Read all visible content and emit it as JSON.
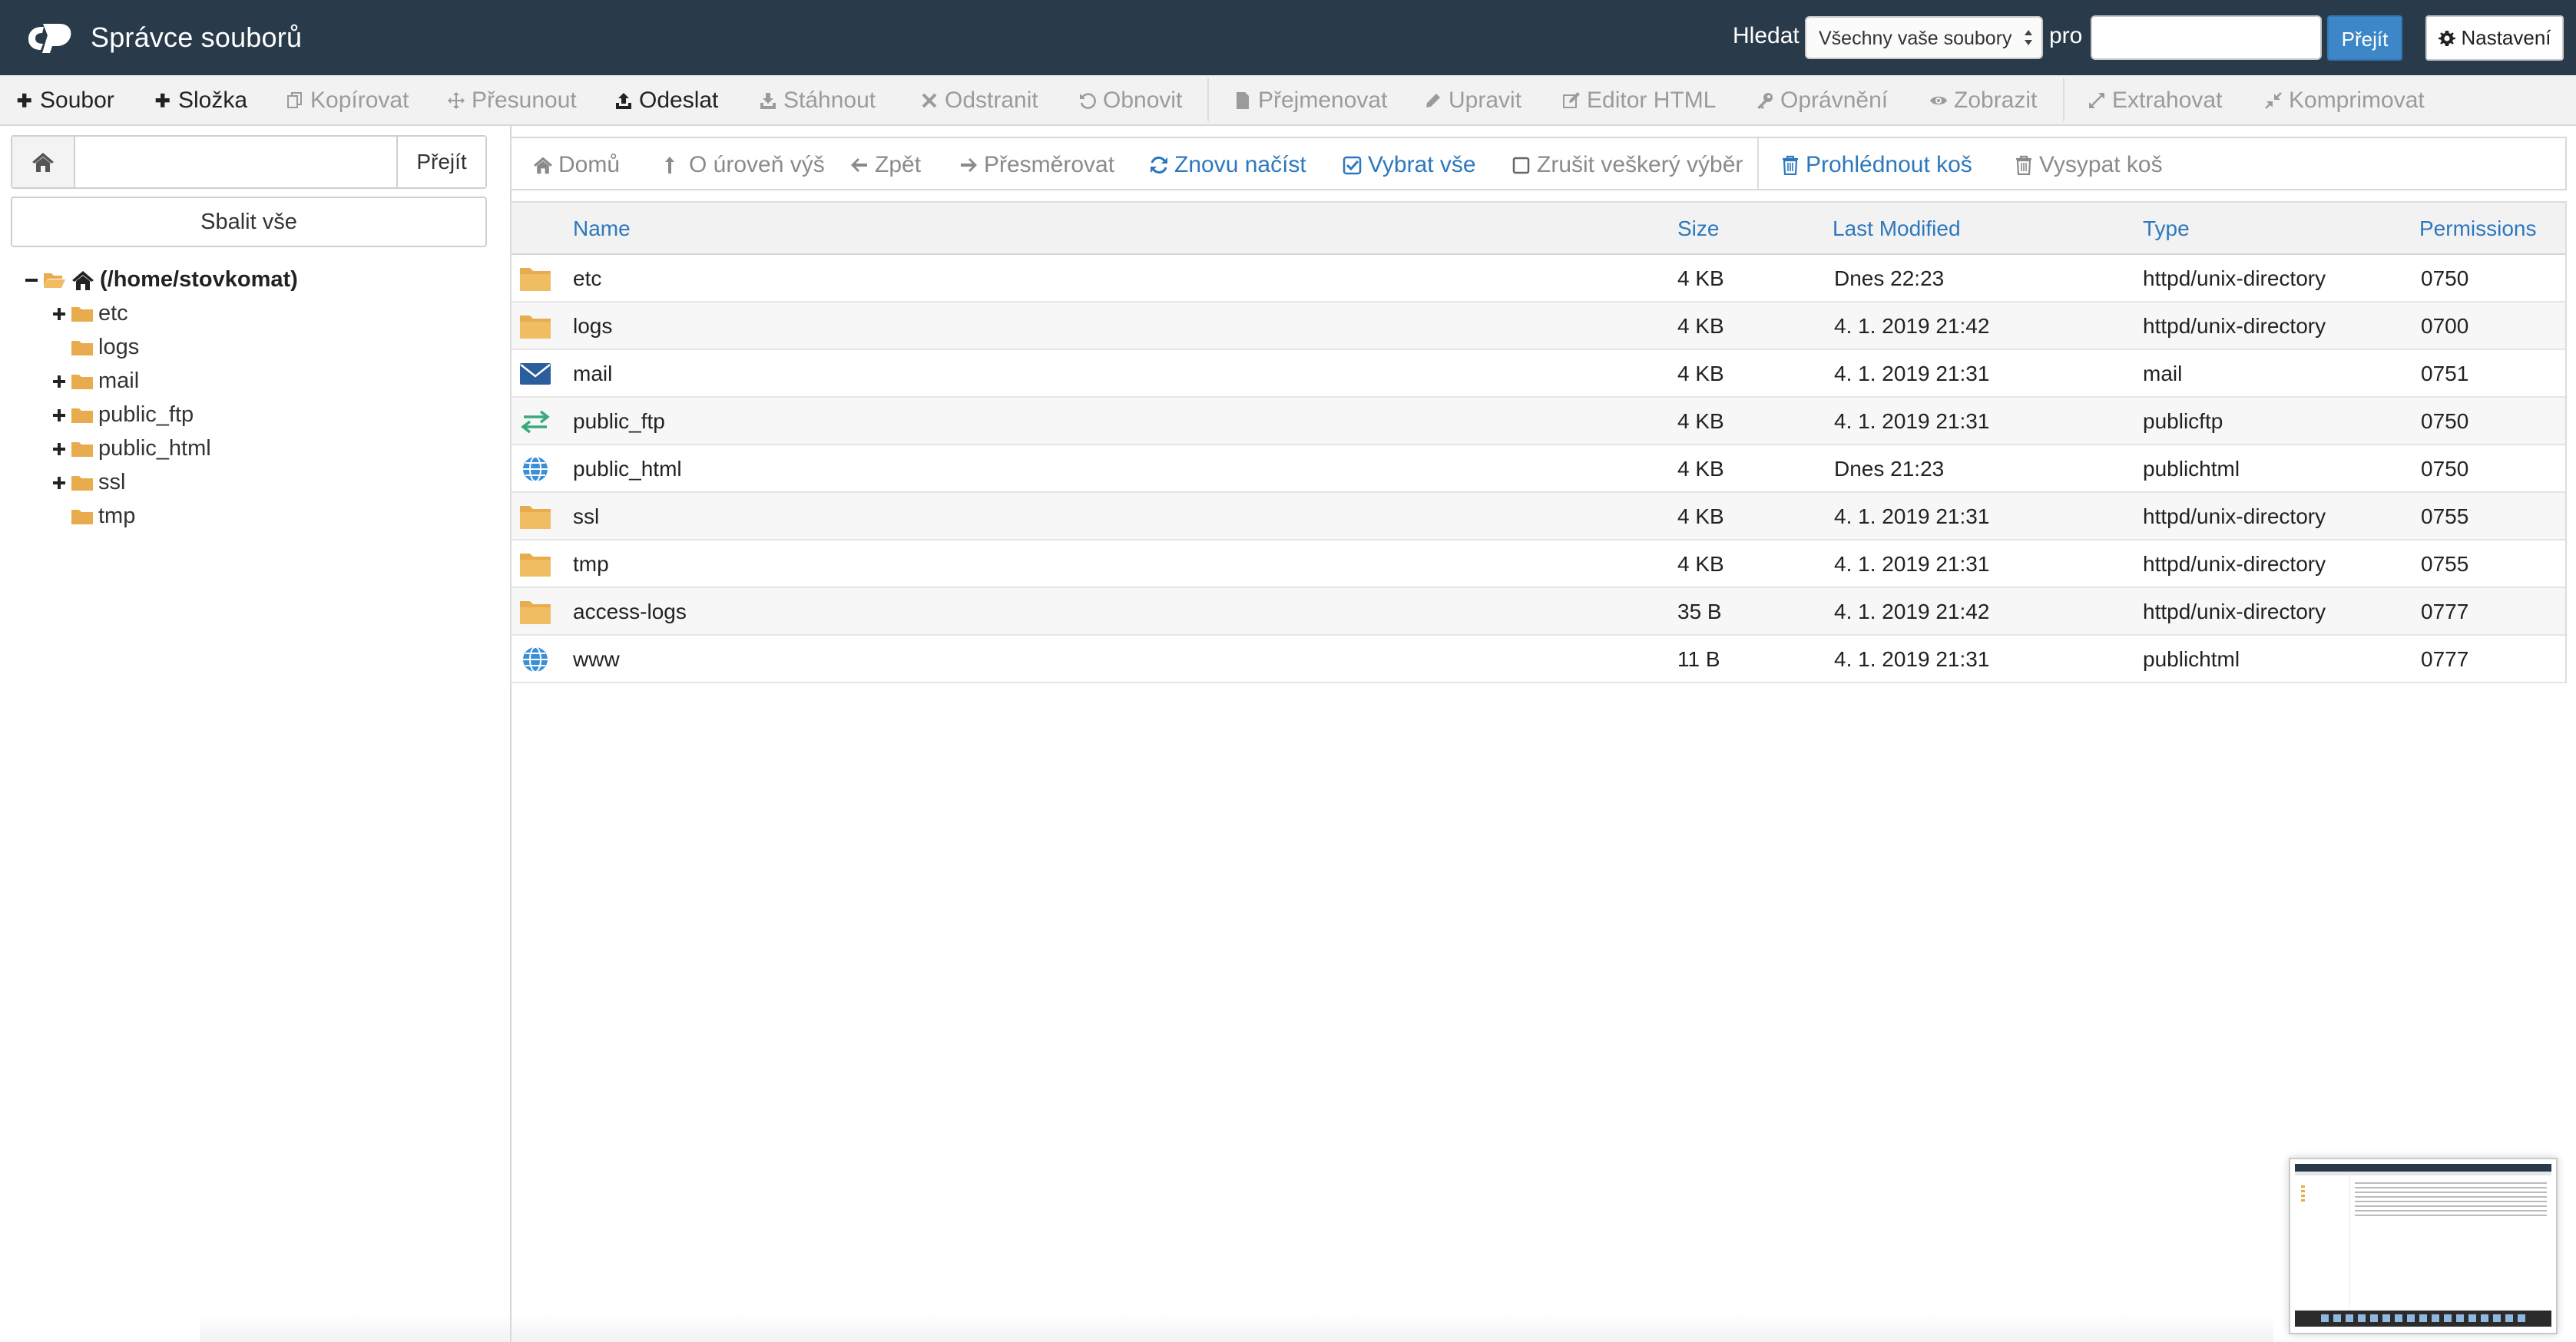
{
  "app": {
    "title": "Správce souborů"
  },
  "search": {
    "label": "Hledat",
    "scope_selected": "Všechny vaše soubory",
    "for_label": "pro",
    "query_value": "",
    "go_label": "Přejít"
  },
  "settings": {
    "label": "Nastavení"
  },
  "toolbar": [
    {
      "key": "file",
      "label": "Soubor",
      "icon": "plus-icon",
      "enabled": true
    },
    {
      "key": "folder",
      "label": "Složka",
      "icon": "plus-icon",
      "enabled": true
    },
    {
      "key": "copy",
      "label": "Kopírovat",
      "icon": "copy-icon",
      "enabled": false
    },
    {
      "key": "move",
      "label": "Přesunout",
      "icon": "move-icon",
      "enabled": false
    },
    {
      "key": "upload",
      "label": "Odeslat",
      "icon": "upload-icon",
      "enabled": true
    },
    {
      "key": "download",
      "label": "Stáhnout",
      "icon": "download-icon",
      "enabled": false
    },
    {
      "key": "delete",
      "label": "Odstranit",
      "icon": "close-icon",
      "enabled": false
    },
    {
      "key": "restore",
      "label": "Obnovit",
      "icon": "undo-icon",
      "enabled": false
    },
    {
      "key": "rename",
      "label": "Přejmenovat",
      "icon": "file-icon",
      "enabled": false
    },
    {
      "key": "edit",
      "label": "Upravit",
      "icon": "pencil-icon",
      "enabled": false
    },
    {
      "key": "html-editor",
      "label": "Editor HTML",
      "icon": "edit-icon",
      "enabled": false
    },
    {
      "key": "permissions",
      "label": "Oprávnění",
      "icon": "key-icon",
      "enabled": false
    },
    {
      "key": "view",
      "label": "Zobrazit",
      "icon": "eye-icon",
      "enabled": false
    },
    {
      "key": "extract",
      "label": "Extrahovat",
      "icon": "expand-icon",
      "enabled": false
    },
    {
      "key": "compress",
      "label": "Komprimovat",
      "icon": "compress-icon",
      "enabled": false
    }
  ],
  "path": {
    "value": "",
    "go_label": "Přejít"
  },
  "tree": {
    "collapse_label": "Sbalit vše",
    "root_label": "(/home/stovkomat)",
    "items": [
      {
        "label": "etc",
        "expandable": true
      },
      {
        "label": "logs",
        "expandable": false
      },
      {
        "label": "mail",
        "expandable": true
      },
      {
        "label": "public_ftp",
        "expandable": true
      },
      {
        "label": "public_html",
        "expandable": true
      },
      {
        "label": "ssl",
        "expandable": true
      },
      {
        "label": "tmp",
        "expandable": false
      }
    ]
  },
  "actions": [
    {
      "key": "home",
      "label": "Domů",
      "icon": "home-icon",
      "enabled": false
    },
    {
      "key": "up",
      "label": "O úroveň výš",
      "icon": "level-up-icon",
      "enabled": false
    },
    {
      "key": "back",
      "label": "Zpět",
      "icon": "arrow-left-icon",
      "enabled": false
    },
    {
      "key": "forward",
      "label": "Přesměrovat",
      "icon": "arrow-right-icon",
      "enabled": false
    },
    {
      "key": "reload",
      "label": "Znovu načíst",
      "icon": "refresh-icon",
      "enabled": true
    },
    {
      "key": "select-all",
      "label": "Vybrat vše",
      "icon": "checkbox-checked-icon",
      "enabled": true
    },
    {
      "key": "unselect-all",
      "label": "Zrušit veškerý výběr",
      "icon": "checkbox-empty-icon",
      "enabled": false
    },
    {
      "key": "view-trash",
      "label": "Prohlédnout koš",
      "icon": "trash-icon",
      "enabled": true
    },
    {
      "key": "empty-trash",
      "label": "Vysypat koš",
      "icon": "trash-icon",
      "enabled": false
    }
  ],
  "table": {
    "columns": {
      "name": "Name",
      "size": "Size",
      "modified": "Last Modified",
      "type": "Type",
      "permissions": "Permissions"
    },
    "rows": [
      {
        "icon": "folder-icon",
        "name": "etc",
        "size": "4 KB",
        "modified": "Dnes 22:23",
        "type": "httpd/unix-directory",
        "permissions": "0750"
      },
      {
        "icon": "folder-icon",
        "name": "logs",
        "size": "4 KB",
        "modified": "4. 1. 2019 21:42",
        "type": "httpd/unix-directory",
        "permissions": "0700"
      },
      {
        "icon": "envelope-icon",
        "name": "mail",
        "size": "4 KB",
        "modified": "4. 1. 2019 21:31",
        "type": "mail",
        "permissions": "0751"
      },
      {
        "icon": "exchange-icon",
        "name": "public_ftp",
        "size": "4 KB",
        "modified": "4. 1. 2019 21:31",
        "type": "publicftp",
        "permissions": "0750"
      },
      {
        "icon": "globe-icon",
        "name": "public_html",
        "size": "4 KB",
        "modified": "Dnes 21:23",
        "type": "publichtml",
        "permissions": "0750"
      },
      {
        "icon": "folder-icon",
        "name": "ssl",
        "size": "4 KB",
        "modified": "4. 1. 2019 21:31",
        "type": "httpd/unix-directory",
        "permissions": "0755"
      },
      {
        "icon": "folder-icon",
        "name": "tmp",
        "size": "4 KB",
        "modified": "4. 1. 2019 21:31",
        "type": "httpd/unix-directory",
        "permissions": "0755"
      },
      {
        "icon": "folder-icon",
        "name": "access-logs",
        "size": "35 B",
        "modified": "4. 1. 2019 21:42",
        "type": "httpd/unix-directory",
        "permissions": "0777"
      },
      {
        "icon": "globe-icon",
        "name": "www",
        "size": "11 B",
        "modified": "4. 1. 2019 21:31",
        "type": "publichtml",
        "permissions": "0777"
      }
    ]
  },
  "colors": {
    "topbar": "#293a4a",
    "accent": "#2d78bd",
    "folder": "#e8ac4e",
    "mail": "#2b5e9c",
    "ftp": "#3aaa7a",
    "globe": "#3a8fd6"
  }
}
